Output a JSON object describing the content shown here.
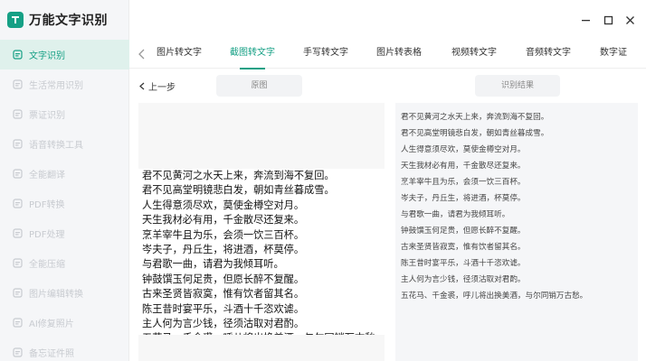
{
  "app": {
    "title": "万能文字识别"
  },
  "sidebar": {
    "items": [
      {
        "label": "文字识别",
        "icon": "text-recognition-icon",
        "active": true
      },
      {
        "label": "生活常用识别",
        "icon": "scan-icon",
        "active": false
      },
      {
        "label": "票证识别",
        "icon": "ticket-icon",
        "active": false
      },
      {
        "label": "语音转换工具",
        "icon": "voice-icon",
        "active": false
      },
      {
        "label": "全能翻译",
        "icon": "translate-icon",
        "active": false
      },
      {
        "label": "PDF转换",
        "icon": "pdf-convert-icon",
        "active": false
      },
      {
        "label": "PDF处理",
        "icon": "pdf-process-icon",
        "active": false
      },
      {
        "label": "全能压缩",
        "icon": "compress-icon",
        "active": false
      },
      {
        "label": "图片编辑转换",
        "icon": "image-edit-icon",
        "active": false
      },
      {
        "label": "AI修复照片",
        "icon": "ai-repair-icon",
        "active": false
      },
      {
        "label": "备忘证件照",
        "icon": "id-photo-icon",
        "active": false
      }
    ]
  },
  "tabs": [
    {
      "label": "图片转文字",
      "active": false
    },
    {
      "label": "截图转文字",
      "active": true
    },
    {
      "label": "手写转文字",
      "active": false
    },
    {
      "label": "图片转表格",
      "active": false
    },
    {
      "label": "视频转文字",
      "active": false
    },
    {
      "label": "音频转文字",
      "active": false
    },
    {
      "label": "数字证",
      "active": false
    }
  ],
  "subheader": {
    "back_label": "上一步",
    "original_label": "原图",
    "result_label": "识别结果"
  },
  "poem_lines": [
    "君不见黄河之水天上来，奔流到海不复回。",
    "君不见高堂明镜悲白发，朝如青丝暮成雪。",
    "人生得意须尽欢，莫使金樽空对月。",
    "天生我材必有用，千金散尽还复来。",
    "烹羊宰牛且为乐，会须一饮三百杯。",
    "岑夫子，丹丘生，将进酒，杯莫停。",
    "与君歌一曲，请君为我倾耳听。",
    "钟鼓馔玉何足贵，但愿长醉不复醒。",
    "古来圣贤皆寂寞，惟有饮者留其名。",
    "陈王昔时宴平乐，斗酒十千恣欢谑。",
    "主人何为言少钱，径须沽取对君酌。",
    "五花马、千金裘，呼儿将出换美酒，与尔同销万古愁。"
  ],
  "colors": {
    "accent": "#16a085",
    "active_bg": "#dff1ec",
    "sidebar_bg": "#f5f6f8"
  }
}
